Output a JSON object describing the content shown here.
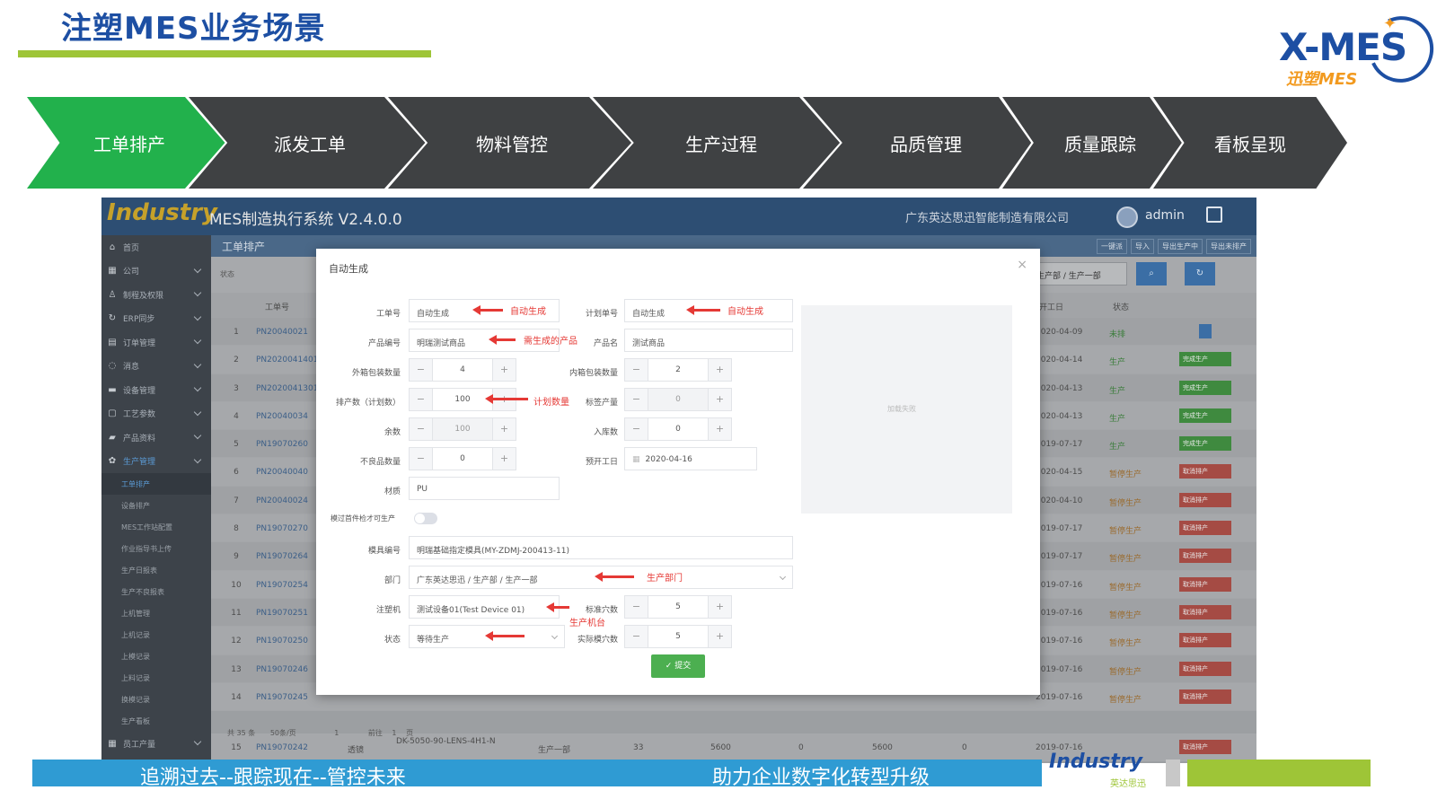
{
  "slide": {
    "title": "注塑MES业务场景",
    "logo_main": "X-MES",
    "logo_sub": "迅塑MES"
  },
  "process": {
    "steps": [
      "工单排产",
      "派发工单",
      "物料管控",
      "生产过程",
      "品质管理",
      "质量跟踪",
      "看板呈现"
    ],
    "active_index": 0,
    "active_color": "#22b14c",
    "inactive_color": "#3f4143"
  },
  "app": {
    "logo_text": "Industry",
    "title": "MES制造执行系统 V2.4.0.0",
    "company": "广东英达思迅智能制造有限公司",
    "user": "admin",
    "sidebar": [
      {
        "label": "首页",
        "icon": "⌂",
        "sub": false
      },
      {
        "label": "公司",
        "icon": "▦",
        "sub": false
      },
      {
        "label": "制程及权限",
        "icon": "♙",
        "sub": false
      },
      {
        "label": "ERP同步",
        "icon": "↻",
        "sub": false
      },
      {
        "label": "订单管理",
        "icon": "▤",
        "sub": false
      },
      {
        "label": "消息",
        "icon": "◌",
        "sub": false
      },
      {
        "label": "设备管理",
        "icon": "▬",
        "sub": false
      },
      {
        "label": "工艺参数",
        "icon": "▢",
        "sub": false
      },
      {
        "label": "产品资料",
        "icon": "▰",
        "sub": false
      },
      {
        "label": "生产管理",
        "icon": "✿",
        "sub": false
      },
      {
        "label": "工单排产",
        "sub": true
      },
      {
        "label": "设备排产",
        "sub": true
      },
      {
        "label": "MES工作站配置",
        "sub": true
      },
      {
        "label": "作业指导书上传",
        "sub": true
      },
      {
        "label": "生产日报表",
        "sub": true
      },
      {
        "label": "生产不良报表",
        "sub": true
      },
      {
        "label": "上机管理",
        "sub": true
      },
      {
        "label": "上机记录",
        "sub": true
      },
      {
        "label": "上模记录",
        "sub": true
      },
      {
        "label": "上料记录",
        "sub": true
      },
      {
        "label": "换模记录",
        "sub": true
      },
      {
        "label": "生产看板",
        "sub": true
      },
      {
        "label": "员工产量",
        "icon": "▦",
        "sub": false
      }
    ],
    "tab_name": "工单排产",
    "toolbar": [
      "一键派",
      "导入",
      "导出生产中",
      "导出未排产"
    ],
    "filter_label": "状态",
    "dept_select": "生产部 / 生产一部",
    "grid_headers": {
      "wo": "工单号",
      "date": "开工日",
      "state": "状态"
    },
    "rows": [
      {
        "no": "1",
        "wo": "PN20040021",
        "date": "2020-04-09",
        "state": "未排",
        "state_type": "green",
        "action": "",
        "action_type": "blue"
      },
      {
        "no": "2",
        "wo": "PN20200414012",
        "date": "2020-04-14",
        "state": "生产",
        "state_type": "green",
        "action": "完成生产",
        "action_type": "green"
      },
      {
        "no": "3",
        "wo": "PN20200413012",
        "date": "2020-04-13",
        "state": "生产",
        "state_type": "green",
        "action": "完成生产",
        "action_type": "green"
      },
      {
        "no": "4",
        "wo": "PN20040034",
        "date": "2020-04-13",
        "state": "生产",
        "state_type": "green",
        "action": "完成生产",
        "action_type": "green"
      },
      {
        "no": "5",
        "wo": "PN19070260",
        "date": "2019-07-17",
        "state": "生产",
        "state_type": "green",
        "action": "完成生产",
        "action_type": "green"
      },
      {
        "no": "6",
        "wo": "PN20040040",
        "date": "2020-04-15",
        "state": "暂停生产",
        "state_type": "orange",
        "action": "取消排产",
        "action_type": "red"
      },
      {
        "no": "7",
        "wo": "PN20040024",
        "date": "2020-04-10",
        "state": "暂停生产",
        "state_type": "orange",
        "action": "取消排产",
        "action_type": "red"
      },
      {
        "no": "8",
        "wo": "PN19070270",
        "date": "2019-07-17",
        "state": "暂停生产",
        "state_type": "orange",
        "action": "取消排产",
        "action_type": "red"
      },
      {
        "no": "9",
        "wo": "PN19070264",
        "date": "2019-07-17",
        "state": "暂停生产",
        "state_type": "orange",
        "action": "取消排产",
        "action_type": "red"
      },
      {
        "no": "10",
        "wo": "PN19070254",
        "date": "2019-07-16",
        "state": "暂停生产",
        "state_type": "orange",
        "action": "取消排产",
        "action_type": "red"
      },
      {
        "no": "11",
        "wo": "PN19070251",
        "date": "2019-07-16",
        "state": "暂停生产",
        "state_type": "orange",
        "action": "取消排产",
        "action_type": "red"
      },
      {
        "no": "12",
        "wo": "PN19070250",
        "date": "2019-07-16",
        "state": "暂停生产",
        "state_type": "orange",
        "action": "取消排产",
        "action_type": "red"
      },
      {
        "no": "13",
        "wo": "PN19070246",
        "date": "2019-07-16",
        "state": "暂停生产",
        "state_type": "orange",
        "action": "取消排产",
        "action_type": "red"
      },
      {
        "no": "14",
        "wo": "PN19070245",
        "date": "2019-07-16",
        "state": "暂停生产",
        "state_type": "orange",
        "action": "取消排产",
        "action_type": "red"
      }
    ],
    "last_row": {
      "no": "15",
      "wo": "PN19070242",
      "material": "透镜",
      "model": "DK-5050-90-LENS-4H1-N",
      "dept": "生产一部",
      "n1": "33",
      "n2": "5600",
      "n3": "0",
      "n4": "5600",
      "n5": "0",
      "date": "2019-07-16",
      "action": "取消排产"
    },
    "pager": {
      "total": "共 35 条",
      "per_page": "50条/页",
      "page": "1",
      "goto_label": "前往",
      "goto_value": "1",
      "unit": "页"
    }
  },
  "modal": {
    "title": "自动生成",
    "fields": {
      "wo_label": "工单号",
      "wo_value": "自动生成",
      "plan_label": "计划单号",
      "plan_value": "自动生成",
      "product_code_label": "产品编号",
      "product_code_value": "明瑞测试商品",
      "product_name_label": "产品名",
      "product_name_value": "测试商品",
      "outer_pack_label": "外箱包装数量",
      "outer_pack_value": "4",
      "inner_pack_label": "内箱包装数量",
      "inner_pack_value": "2",
      "plan_qty_label": "排产数（计划数）",
      "plan_qty_value": "100",
      "std_output_label": "标签产量",
      "std_output_value": "0",
      "remain_label": "余数",
      "remain_value": "100",
      "stock_in_label": "入库数",
      "stock_in_value": "0",
      "defect_label": "不良品数量",
      "defect_value": "0",
      "start_date_label": "预开工日",
      "start_date_value": "2020-04-16",
      "material_label": "材质",
      "material_value": "PU",
      "toggle_label": "模过首件检才可生产",
      "mold_label": "模具编号",
      "mold_value": "明瑞基础指定模具(MY-ZDMJ-200413-11)",
      "dept_label": "部门",
      "dept_value": "广东英达思迅 / 生产部 / 生产一部",
      "machine_label": "注塑机",
      "machine_value": "测试设备01(Test Device 01)",
      "std_cavity_label": "标准穴数",
      "std_cavity_value": "5",
      "status_label": "状态",
      "status_value": "等待生产",
      "actual_cavity_label": "实际模穴数",
      "actual_cavity_value": "5"
    },
    "image_placeholder": "加载失败",
    "submit": "✓ 提交",
    "annotations": {
      "a1": "自动生成",
      "a2": "自动生成",
      "a3": "需生成的产品",
      "a4": "计划数量",
      "a5": "生产部门",
      "a6": "生产机台"
    },
    "annotation_color": "#e53935"
  },
  "footer": {
    "left": "追溯过去--跟踪现在--管控未来",
    "right": "助力企业数字化转型升级",
    "logo": "Industry",
    "logo_sub": "英达思迅"
  }
}
